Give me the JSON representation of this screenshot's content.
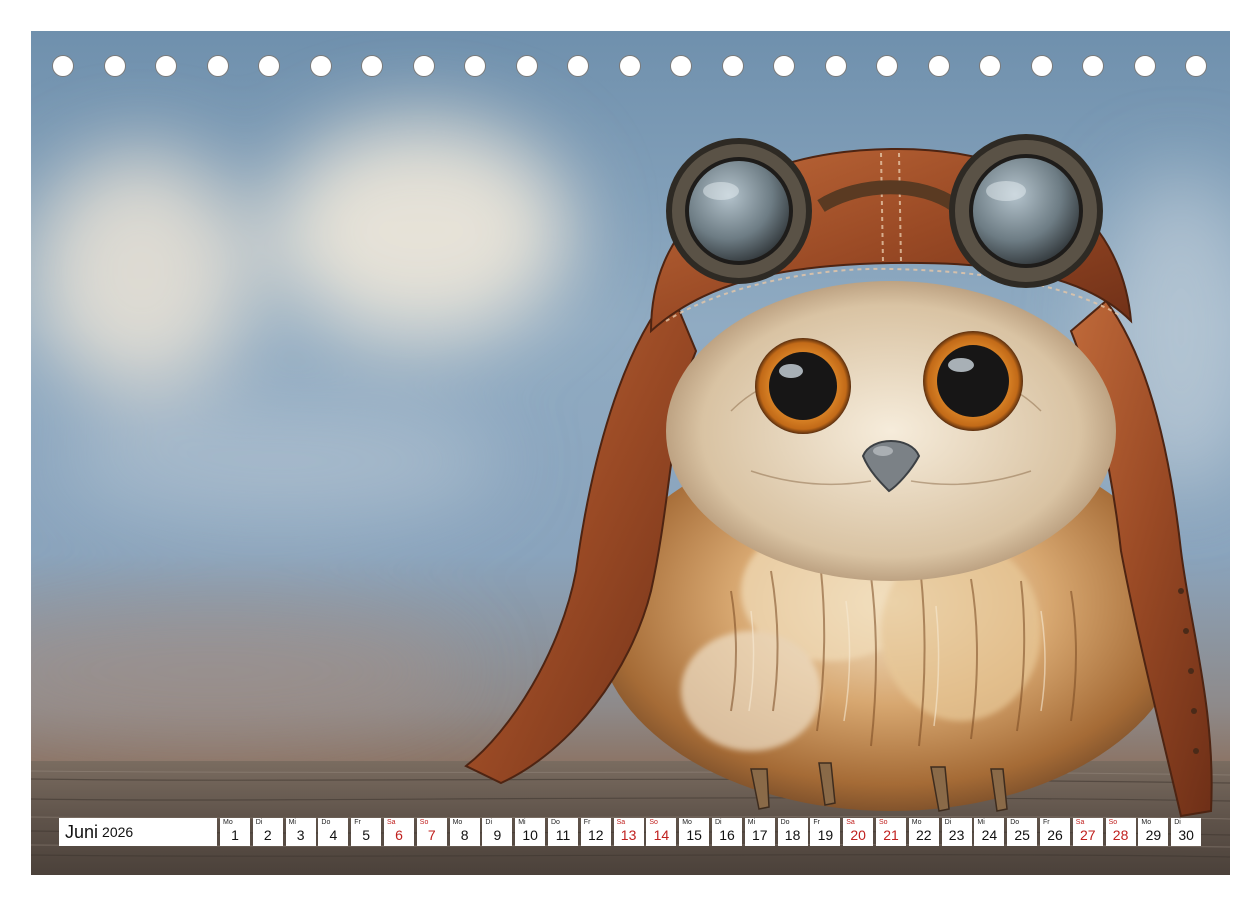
{
  "calendar": {
    "month": "Juni",
    "year": "2026",
    "days": [
      {
        "dow": "Mo",
        "day": "1",
        "weekend": false
      },
      {
        "dow": "Di",
        "day": "2",
        "weekend": false
      },
      {
        "dow": "Mi",
        "day": "3",
        "weekend": false
      },
      {
        "dow": "Do",
        "day": "4",
        "weekend": false
      },
      {
        "dow": "Fr",
        "day": "5",
        "weekend": false
      },
      {
        "dow": "Sa",
        "day": "6",
        "weekend": true
      },
      {
        "dow": "So",
        "day": "7",
        "weekend": true
      },
      {
        "dow": "Mo",
        "day": "8",
        "weekend": false
      },
      {
        "dow": "Di",
        "day": "9",
        "weekend": false
      },
      {
        "dow": "Mi",
        "day": "10",
        "weekend": false
      },
      {
        "dow": "Do",
        "day": "11",
        "weekend": false
      },
      {
        "dow": "Fr",
        "day": "12",
        "weekend": false
      },
      {
        "dow": "Sa",
        "day": "13",
        "weekend": true
      },
      {
        "dow": "So",
        "day": "14",
        "weekend": true
      },
      {
        "dow": "Mo",
        "day": "15",
        "weekend": false
      },
      {
        "dow": "Di",
        "day": "16",
        "weekend": false
      },
      {
        "dow": "Mi",
        "day": "17",
        "weekend": false
      },
      {
        "dow": "Do",
        "day": "18",
        "weekend": false
      },
      {
        "dow": "Fr",
        "day": "19",
        "weekend": false
      },
      {
        "dow": "Sa",
        "day": "20",
        "weekend": true
      },
      {
        "dow": "So",
        "day": "21",
        "weekend": true
      },
      {
        "dow": "Mo",
        "day": "22",
        "weekend": false
      },
      {
        "dow": "Di",
        "day": "23",
        "weekend": false
      },
      {
        "dow": "Mi",
        "day": "24",
        "weekend": false
      },
      {
        "dow": "Do",
        "day": "25",
        "weekend": false
      },
      {
        "dow": "Fr",
        "day": "26",
        "weekend": false
      },
      {
        "dow": "Sa",
        "day": "27",
        "weekend": true
      },
      {
        "dow": "So",
        "day": "28",
        "weekend": true
      },
      {
        "dow": "Mo",
        "day": "29",
        "weekend": false
      },
      {
        "dow": "Di",
        "day": "30",
        "weekend": false
      }
    ]
  },
  "colors": {
    "weekend": "#c0201e",
    "sky": "#7f9cb8",
    "wood": "#6b5f55"
  },
  "icons": {
    "binding_holes": "ring-hole-icon",
    "photo": "owl-pilot-illustration"
  }
}
